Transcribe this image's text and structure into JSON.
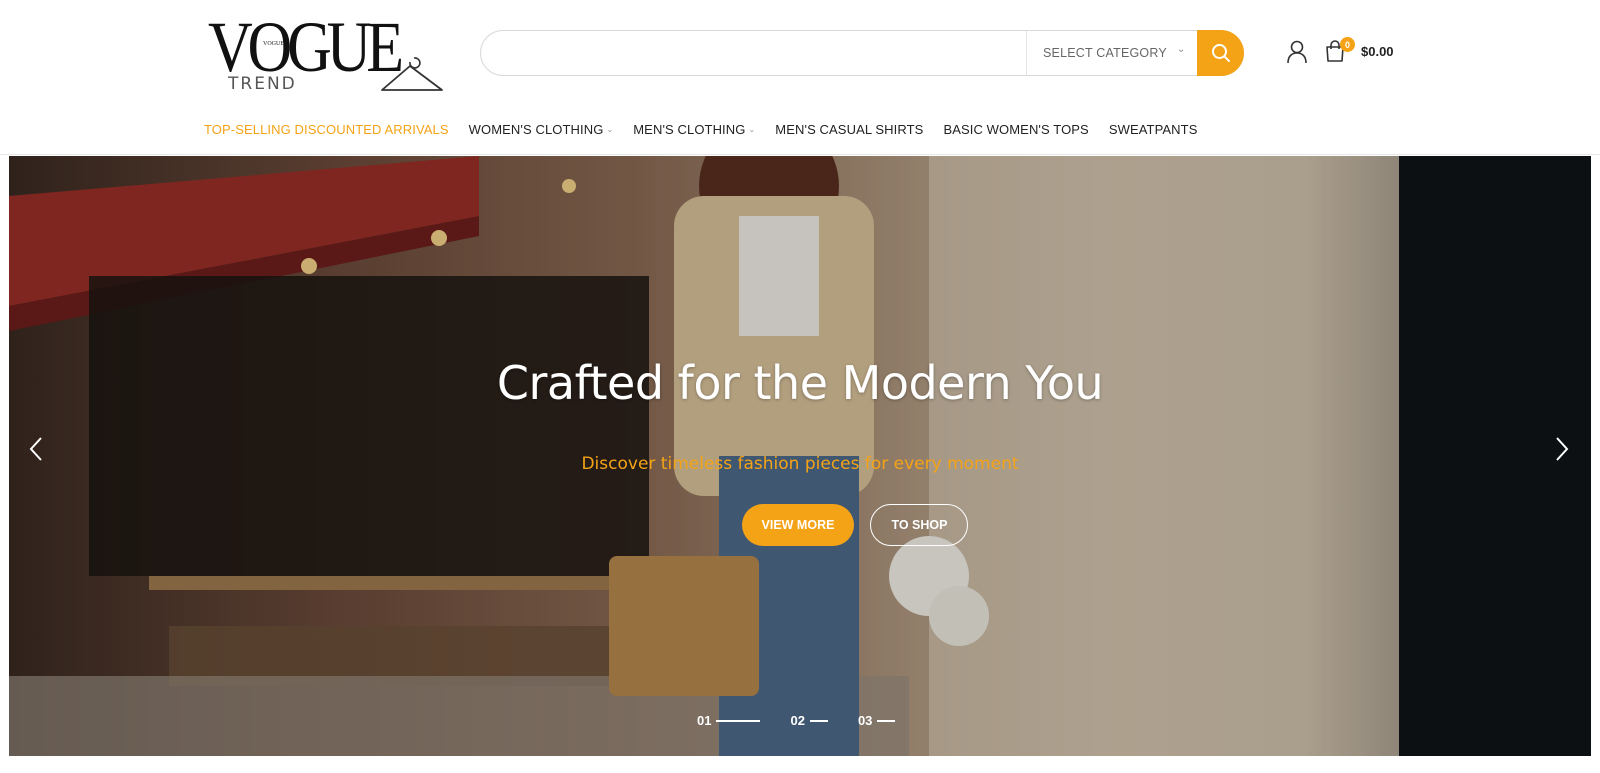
{
  "brand": {
    "logo_word": "VOGUE",
    "logo_small": "VOGUE",
    "logo_sub": "TREND"
  },
  "search": {
    "value": "",
    "placeholder": "",
    "category_label": "SELECT CATEGORY"
  },
  "cart": {
    "count": "0",
    "total": "$0.00"
  },
  "nav": {
    "items": [
      {
        "label": "TOP-SELLING DISCOUNTED ARRIVALS",
        "active": true
      },
      {
        "label": "WOMEN'S CLOTHING",
        "dropdown": true
      },
      {
        "label": "MEN'S CLOTHING",
        "dropdown": true
      },
      {
        "label": "MEN'S CASUAL SHIRTS"
      },
      {
        "label": "BASIC WOMEN'S TOPS"
      },
      {
        "label": "SWEATPANTS"
      }
    ]
  },
  "hero": {
    "title": "Crafted for the Modern You",
    "subtitle": "Discover timeless fashion pieces for every moment",
    "primary_button": "VIEW MORE",
    "secondary_button": "TO SHOP",
    "slides": [
      "01",
      "02",
      "03"
    ],
    "active_slide": "01"
  },
  "colors": {
    "accent": "#f5a316",
    "text": "#222222",
    "white": "#ffffff"
  },
  "icons": {
    "search": "search-icon",
    "user": "user-icon",
    "cart": "shopping-bag-icon",
    "prev": "chevron-left-icon",
    "next": "chevron-right-icon",
    "dropdown": "chevron-down-icon"
  }
}
